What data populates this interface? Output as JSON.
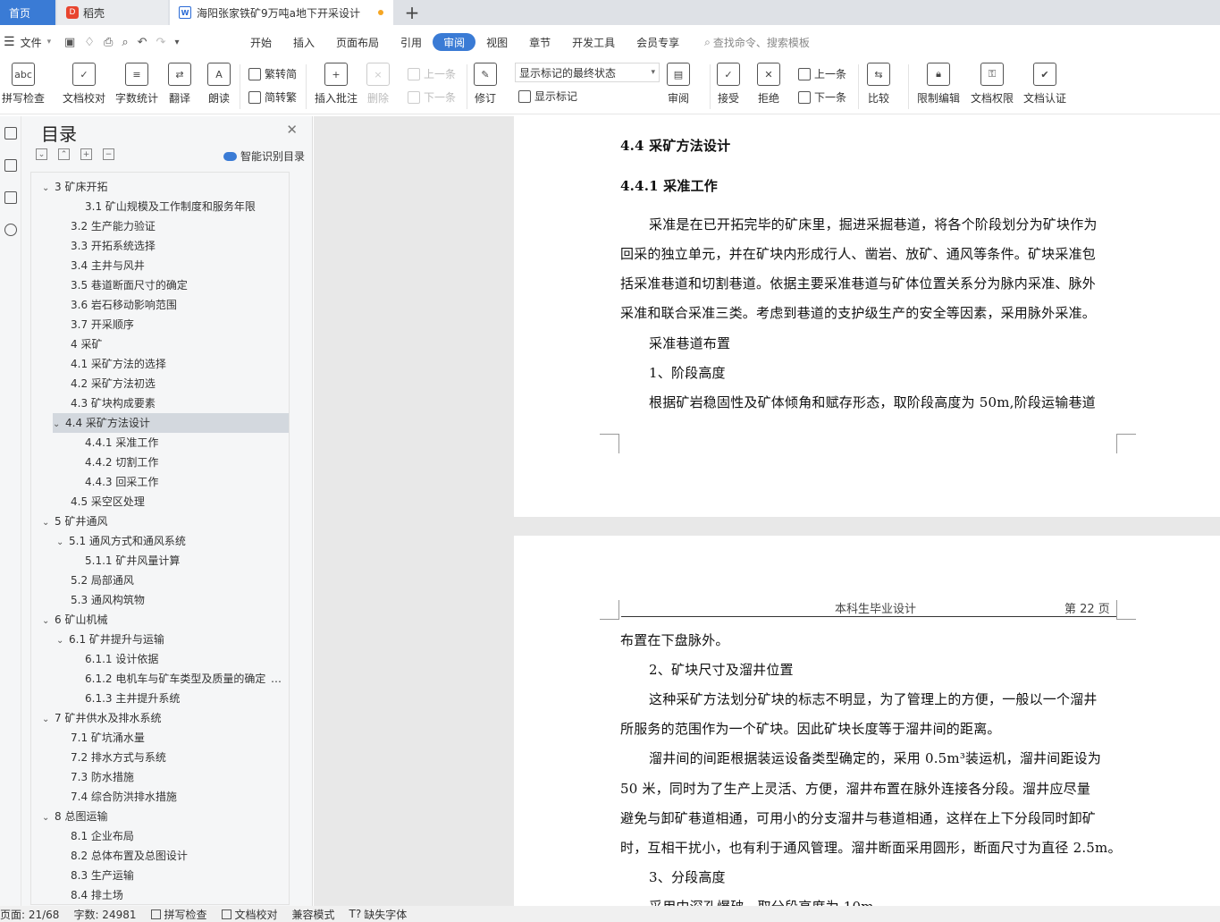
{
  "tabs": {
    "home": "首页",
    "docer": "稻壳",
    "doc": "海阳张家铁矿9万吨a地下开采设计"
  },
  "menu": {
    "file": "文件",
    "items": [
      "开始",
      "插入",
      "页面布局",
      "引用",
      "审阅",
      "视图",
      "章节",
      "开发工具",
      "会员专享"
    ],
    "active": "审阅",
    "search": "查找命令、搜索模板"
  },
  "ribbon": {
    "spellcheck": "拼写检查",
    "doccheck": "文档校对",
    "wordcount": "字数统计",
    "translate": "翻译",
    "read": "朗读",
    "trad2simp": "繁转简",
    "simp2trad": "简转繁",
    "insert_comment": "插入批注",
    "delete": "删除",
    "prev": "上一条",
    "next": "下一条",
    "revise": "修订",
    "markup_state": "显示标记的最终状态",
    "show_markup": "显示标记",
    "review": "审阅",
    "accept": "接受",
    "reject": "拒绝",
    "prev2": "上一条",
    "next2": "下一条",
    "compare": "比较",
    "restrict": "限制编辑",
    "permission": "文档权限",
    "certify": "文档认证"
  },
  "toc": {
    "title": "目录",
    "smart": "智能识别目录",
    "items": [
      "3 矿床开拓",
      "3.1 矿山规模及工作制度和服务年限",
      "3.2 生产能力验证",
      "3.3 开拓系统选择",
      "3.4 主井与风井",
      "3.5 巷道断面尺寸的确定",
      "3.6 岩石移动影响范围",
      "3.7 开采顺序",
      "4 采矿",
      "4.1 采矿方法的选择",
      "4.2 采矿方法初选",
      "4.3 矿块构成要素",
      "4.4 采矿方法设计",
      "4.4.1 采准工作",
      "4.4.2 切割工作",
      "4.4.3 回采工作",
      "4.5 采空区处理",
      "5 矿井通风",
      "5.1 通风方式和通风系统",
      "5.1.1 矿井风量计算",
      "5.2 局部通风",
      "5.3 通风构筑物",
      "6 矿山机械",
      "6.1 矿井提升与运输",
      "6.1.1 设计依据",
      "6.1.2 电机车与矿车类型及质量的确定",
      "6.1.3 主井提升系统",
      "7 矿井供水及排水系统",
      "7.1 矿坑涌水量",
      "7.2 排水方式与系统",
      "7.3 防水措施",
      "7.4 综合防洪排水措施",
      "8 总图运输",
      "8.1 企业布局",
      "8.2 总体布置及总图设计",
      "8.3 生产运输",
      "8.4 排土场"
    ]
  },
  "page1": {
    "h1": "4.4  采矿方法设计",
    "h2": "4.4.1  采准工作",
    "lines": [
      "采准是在已开拓完毕的矿床里，掘进采掘巷道，将各个阶段划分为矿块作为",
      "回采的独立单元，并在矿块内形成行人、凿岩、放矿、通风等条件。矿块采准包",
      "括采准巷道和切割巷道。依据主要采准巷道与矿体位置关系分为脉内采准、脉外",
      "采准和联合采准三类。考虑到巷道的支护级生产的安全等因素，采用脉外采准。",
      "采准巷道布置",
      "1、阶段高度",
      "根据矿岩稳固性及矿体倾角和赋存形态，取阶段高度为 50m,阶段运输巷道"
    ]
  },
  "page2": {
    "header_title": "本科生毕业设计",
    "header_page": "第  22  页",
    "lines": [
      "布置在下盘脉外。",
      "2、矿块尺寸及溜井位置",
      "这种采矿方法划分矿块的标志不明显，为了管理上的方便，一般以一个溜井",
      "所服务的范围作为一个矿块。因此矿块长度等于溜井间的距离。",
      "溜井间的间距根据装运设备类型确定的，采用 0.5m³装运机，溜井间距设为",
      "50 米，同时为了生产上灵活、方便，溜井布置在脉外连接各分段。溜井应尽量",
      "避免与卸矿巷道相通，可用小的分支溜井与巷道相通，这样在上下分段同时卸矿",
      "时，互相干扰小，也有利于通风管理。溜井断面采用圆形，断面尺寸为直径 2.5m。",
      "3、分段高度",
      "采用中深孔爆破，取分段高度为 10m"
    ]
  },
  "status": {
    "page": "页面: 21/68",
    "words": "字数: 24981",
    "spell": "拼写检查",
    "check": "文档校对",
    "compat": "兼容模式",
    "fonts": "缺失字体"
  }
}
